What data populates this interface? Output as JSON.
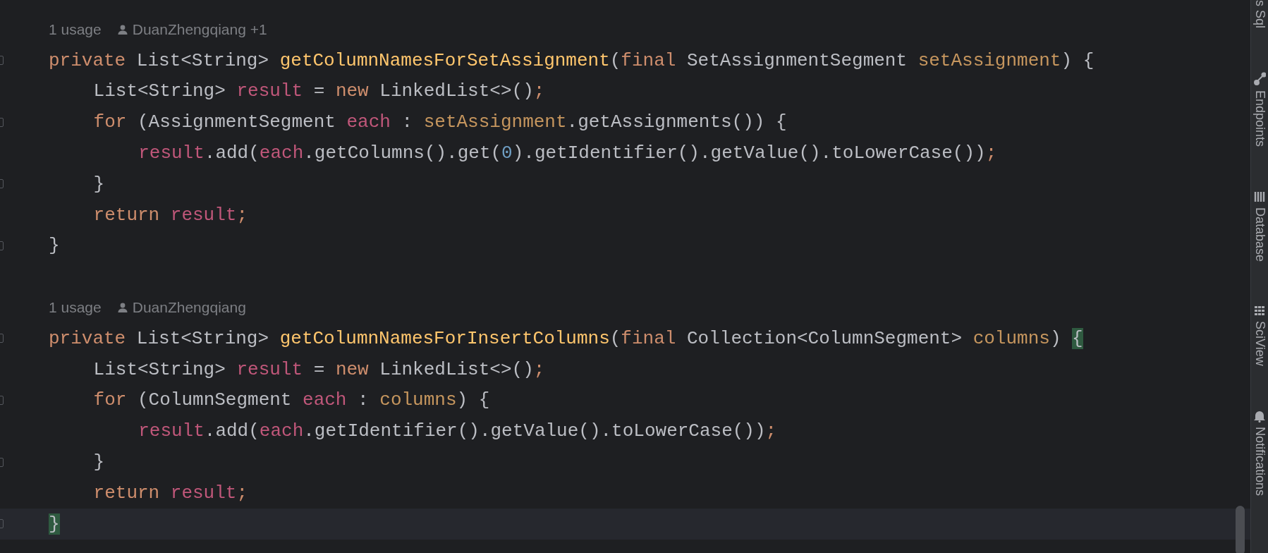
{
  "editor": {
    "blocks": [
      {
        "hint": {
          "usages": "1 usage",
          "author": "DuanZhengqiang +1"
        },
        "lines": [
          {
            "fold": true,
            "tokens": [
              {
                "text": "private ",
                "kind": "keyword"
              },
              {
                "text": "List<String> ",
                "kind": "plain"
              },
              {
                "text": "getColumnNamesForSetAssignment",
                "kind": "method"
              },
              {
                "text": "(",
                "kind": "plain"
              },
              {
                "text": "final ",
                "kind": "keyword"
              },
              {
                "text": "SetAssignmentSegment ",
                "kind": "plain"
              },
              {
                "text": "setAssignment",
                "kind": "param"
              },
              {
                "text": ") {",
                "kind": "plain"
              }
            ],
            "children": [
              {
                "fold": false,
                "tokens": [
                  {
                    "text": "List<String> ",
                    "kind": "plain"
                  },
                  {
                    "text": "result",
                    "kind": "local"
                  },
                  {
                    "text": " = ",
                    "kind": "plain"
                  },
                  {
                    "text": "new ",
                    "kind": "keyword"
                  },
                  {
                    "text": "LinkedList<>()",
                    "kind": "plain"
                  },
                  {
                    "text": ";",
                    "kind": "keyword"
                  }
                ]
              },
              {
                "fold": true,
                "tokens": [
                  {
                    "text": "for ",
                    "kind": "keyword"
                  },
                  {
                    "text": "(AssignmentSegment ",
                    "kind": "plain"
                  },
                  {
                    "text": "each",
                    "kind": "local"
                  },
                  {
                    "text": " : ",
                    "kind": "plain"
                  },
                  {
                    "text": "setAssignment",
                    "kind": "param"
                  },
                  {
                    "text": ".getAssignments()) {",
                    "kind": "plain"
                  }
                ],
                "children": [
                  {
                    "fold": false,
                    "tokens": [
                      {
                        "text": "result",
                        "kind": "local"
                      },
                      {
                        "text": ".add(",
                        "kind": "plain"
                      },
                      {
                        "text": "each",
                        "kind": "local"
                      },
                      {
                        "text": ".getColumns().get(",
                        "kind": "plain"
                      },
                      {
                        "text": "0",
                        "kind": "number"
                      },
                      {
                        "text": ").getIdentifier().getValue().toLowerCase())",
                        "kind": "plain"
                      },
                      {
                        "text": ";",
                        "kind": "keyword"
                      }
                    ]
                  }
                ]
              },
              {
                "fold": true,
                "tokens": [
                  {
                    "text": "}",
                    "kind": "plain"
                  }
                ]
              },
              {
                "fold": false,
                "tokens": [
                  {
                    "text": "return ",
                    "kind": "keyword"
                  },
                  {
                    "text": "result",
                    "kind": "local"
                  },
                  {
                    "text": ";",
                    "kind": "keyword"
                  }
                ]
              }
            ]
          },
          {
            "fold": true,
            "tokens": [
              {
                "text": "}",
                "kind": "plain"
              }
            ]
          }
        ]
      },
      {
        "hint": {
          "usages": "1 usage",
          "author": "DuanZhengqiang"
        },
        "lines": [
          {
            "fold": true,
            "tokens": [
              {
                "text": "private ",
                "kind": "keyword"
              },
              {
                "text": "List<String> ",
                "kind": "plain"
              },
              {
                "text": "getColumnNamesForInsertColumns",
                "kind": "method"
              },
              {
                "text": "(",
                "kind": "plain"
              },
              {
                "text": "final ",
                "kind": "keyword"
              },
              {
                "text": "Collection<ColumnSegment> ",
                "kind": "plain"
              },
              {
                "text": "columns",
                "kind": "param"
              },
              {
                "text": ") ",
                "kind": "plain"
              },
              {
                "text": "{",
                "kind": "plain",
                "matched": true
              }
            ],
            "children": [
              {
                "fold": false,
                "tokens": [
                  {
                    "text": "List<String> ",
                    "kind": "plain"
                  },
                  {
                    "text": "result",
                    "kind": "local"
                  },
                  {
                    "text": " = ",
                    "kind": "plain"
                  },
                  {
                    "text": "new ",
                    "kind": "keyword"
                  },
                  {
                    "text": "LinkedList<>()",
                    "kind": "plain"
                  },
                  {
                    "text": ";",
                    "kind": "keyword"
                  }
                ]
              },
              {
                "fold": true,
                "tokens": [
                  {
                    "text": "for ",
                    "kind": "keyword"
                  },
                  {
                    "text": "(ColumnSegment ",
                    "kind": "plain"
                  },
                  {
                    "text": "each",
                    "kind": "local"
                  },
                  {
                    "text": " : ",
                    "kind": "plain"
                  },
                  {
                    "text": "columns",
                    "kind": "param"
                  },
                  {
                    "text": ") {",
                    "kind": "plain"
                  }
                ],
                "children": [
                  {
                    "fold": false,
                    "tokens": [
                      {
                        "text": "result",
                        "kind": "local"
                      },
                      {
                        "text": ".add(",
                        "kind": "plain"
                      },
                      {
                        "text": "each",
                        "kind": "local"
                      },
                      {
                        "text": ".getIdentifier().getValue().toLowerCase())",
                        "kind": "plain"
                      },
                      {
                        "text": ";",
                        "kind": "keyword"
                      }
                    ]
                  }
                ]
              },
              {
                "fold": true,
                "tokens": [
                  {
                    "text": "}",
                    "kind": "plain"
                  }
                ]
              },
              {
                "fold": false,
                "tokens": [
                  {
                    "text": "return ",
                    "kind": "keyword"
                  },
                  {
                    "text": "result",
                    "kind": "local"
                  },
                  {
                    "text": ";",
                    "kind": "keyword"
                  }
                ]
              }
            ]
          },
          {
            "fold": true,
            "current": true,
            "tokens": [
              {
                "text": "}",
                "kind": "plain",
                "matched": true
              }
            ]
          }
        ]
      }
    ]
  },
  "tool_strip": {
    "items": [
      {
        "label": "s Sql",
        "kind": "plain"
      },
      {
        "label": "Endpoints",
        "kind": "graph"
      },
      {
        "label": "Database",
        "kind": "cylinder"
      },
      {
        "label": "SciView",
        "kind": "grid"
      },
      {
        "label": "Notifications",
        "kind": "bell"
      }
    ]
  }
}
